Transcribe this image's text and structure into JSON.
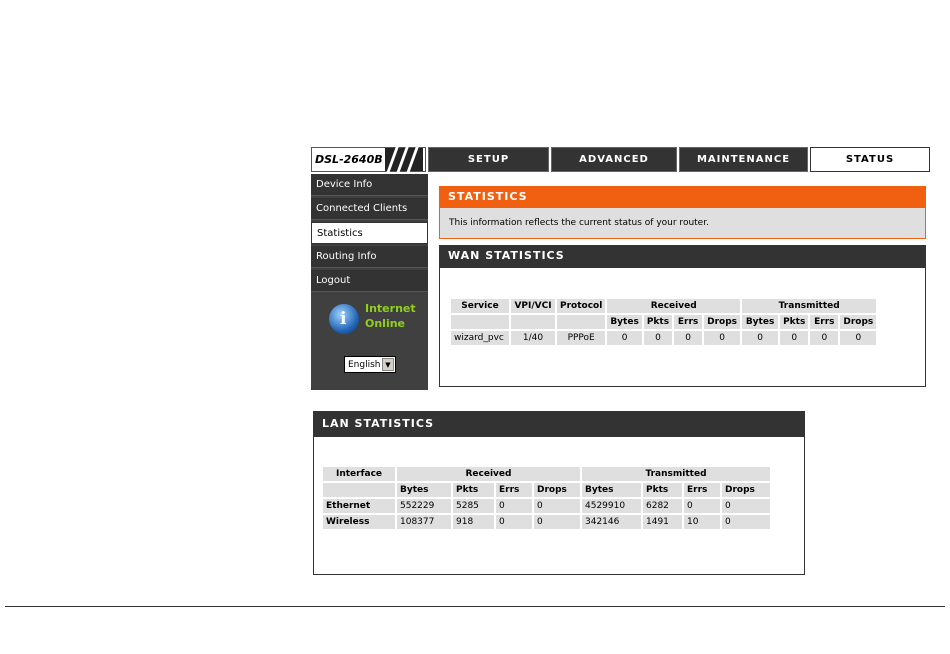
{
  "header": {
    "model": "DSL-2640B",
    "tabs": [
      "SETUP",
      "ADVANCED",
      "MAINTENANCE",
      "STATUS"
    ]
  },
  "sidebar": {
    "items": [
      "Device Info",
      "Connected Clients",
      "Statistics",
      "Routing Info",
      "Logout"
    ],
    "internet_line1": "Internet",
    "internet_line2": "Online",
    "language": "English"
  },
  "statistics": {
    "title": "STATISTICS",
    "description": "This information reflects the current status of your router."
  },
  "wan": {
    "title": "WAN STATISTICS",
    "headers": [
      "Service",
      "VPI/VCI",
      "Protocol",
      "Received",
      "Transmitted"
    ],
    "subheaders": [
      "Bytes",
      "Pkts",
      "Errs",
      "Drops",
      "Bytes",
      "Pkts",
      "Errs",
      "Drops"
    ],
    "rows": [
      [
        "wizard_pvc",
        "1/40",
        "PPPoE",
        "0",
        "0",
        "0",
        "0",
        "0",
        "0",
        "0",
        "0"
      ]
    ]
  },
  "lan": {
    "title": "LAN STATISTICS",
    "headers": [
      "Interface",
      "Received",
      "Transmitted"
    ],
    "subheaders": [
      "Bytes",
      "Pkts",
      "Errs",
      "Drops",
      "Bytes",
      "Pkts",
      "Errs",
      "Drops"
    ],
    "rows": [
      [
        "Ethernet",
        "552229",
        "5285",
        "0",
        "0",
        "4529910",
        "6282",
        "0",
        "0"
      ],
      [
        "Wireless",
        "108377",
        "918",
        "0",
        "0",
        "342146",
        "1491",
        "10",
        "0"
      ]
    ]
  },
  "colors": {
    "accent": "#f06010",
    "internet_online": "#8fd11a",
    "dark": "#333333"
  }
}
